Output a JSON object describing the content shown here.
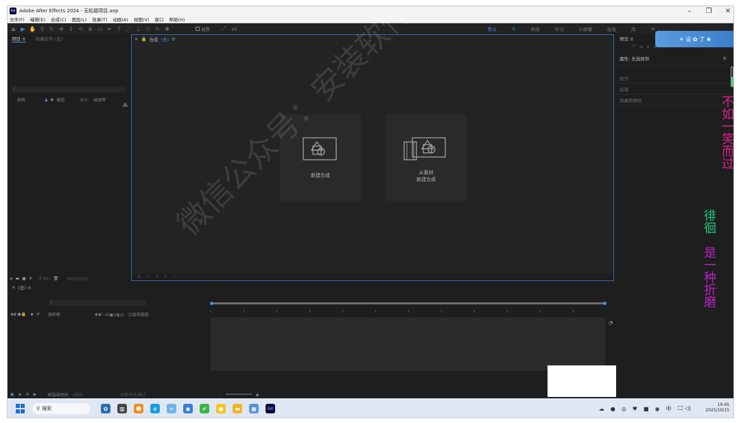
{
  "window": {
    "badge": "Ae",
    "title": "Adobe After Effects 2024 - 无标题项目.aep",
    "controls": {
      "minimize": "–",
      "maximize": "❐",
      "close": "✕"
    }
  },
  "menu": [
    "文件(F)",
    "编辑(E)",
    "合成(C)",
    "图层(L)",
    "效果(T)",
    "动画(A)",
    "视图(V)",
    "窗口",
    "帮助(H)"
  ],
  "toolbar": {
    "align_label": "对齐",
    "workspaces": [
      "默认",
      "≡",
      "审阅",
      "学习",
      "小屏幕",
      "标准",
      "库",
      "≫"
    ]
  },
  "project_panel": {
    "tabs": [
      "项目 ≡",
      "效果控件 (无)"
    ],
    "search_icon": "⌕",
    "columns": {
      "name": "名称",
      "type": "类型",
      "size": "大小",
      "framerate": "帧速率"
    },
    "footer_bpc": "8 bpc"
  },
  "composition_panel": {
    "tab_prefix": "合成",
    "tab_value": "(无)",
    "menu": "≡",
    "new_comp": "新建合成",
    "from_footage_line1": "从素材",
    "from_footage_line2": "新建合成"
  },
  "right_panel": {
    "preview_tab": "预览 ≡",
    "properties": "属性: 无选择项",
    "menu": "≡",
    "rows": [
      "排齐",
      "段落",
      "效果和预设"
    ]
  },
  "timeline": {
    "tab": "(无) ≡",
    "columns": {
      "source": "源名称",
      "parent": "父级和链接"
    },
    "footer_render": "帧渲染时间",
    "footer_render_val": "0毫秒",
    "footer_switch": "切换开关/模式"
  },
  "banner_text": "☀ 设 ✿ 了 ❀",
  "vertical_texts": {
    "t1": "不如一笑而过",
    "t2": "徘徊",
    "t3": "是一种折磨"
  },
  "watermark": "微信公众号：安装软件指南",
  "taskbar": {
    "search_placeholder": "搜索",
    "time": "19:45",
    "date": "2025/10/15",
    "lang": "中"
  },
  "colors": {
    "accent": "#4a8ee0",
    "vtext1": "#e21f8c",
    "vtext2": "#20d07e",
    "vtext3": "#b824c8"
  }
}
